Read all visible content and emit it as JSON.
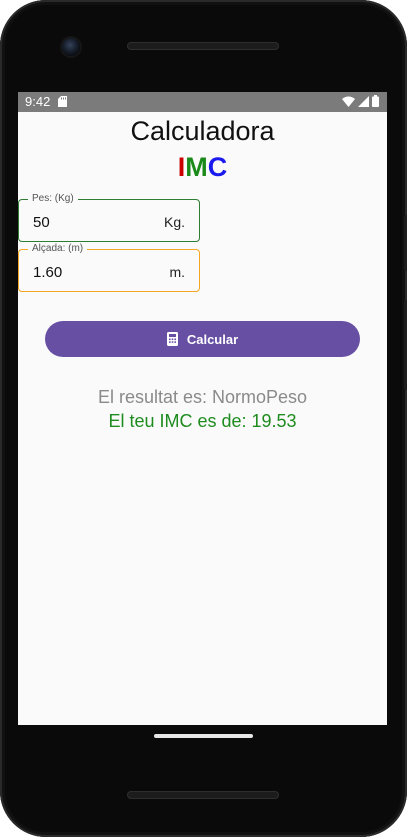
{
  "status_bar": {
    "time": "9:42"
  },
  "app": {
    "title": "Calculadora",
    "subtitle_letters": [
      {
        "char": "I",
        "color": "#cc0000"
      },
      {
        "char": "M",
        "color": "#1a8a1a"
      },
      {
        "char": "C",
        "color": "#1a1aee"
      }
    ]
  },
  "weight_field": {
    "label": "Pes: (Kg)",
    "value": "50",
    "suffix": "Kg.",
    "border_color": "#2e7d32"
  },
  "height_field": {
    "label": "Alçada: (m)",
    "value": "1.60",
    "suffix": "m.",
    "border_color": "#f5a623"
  },
  "calculate_button": {
    "label": "Calcular",
    "icon": "calculator-icon",
    "color": "#6750a4"
  },
  "result": {
    "category_text": "El resultat es: NormoPeso",
    "imc_text": "El teu IMC es de: 19.53",
    "imc_color": "#1e8c1e"
  },
  "colors": {
    "screen_bg": "#fafafa",
    "status_bar_bg": "#7b7b7b"
  }
}
